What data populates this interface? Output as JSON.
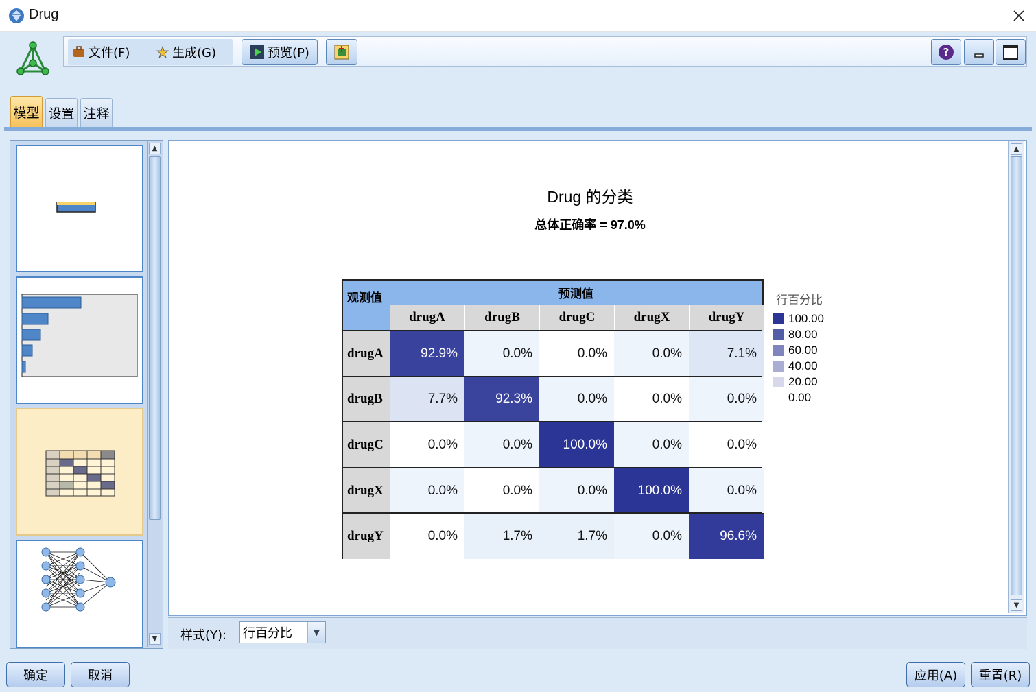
{
  "window": {
    "title": "Drug"
  },
  "toolbar": {
    "file_menu": "文件(F)",
    "generate_menu": "生成(G)",
    "preview_button": "预览(P)"
  },
  "tabs": [
    {
      "label": "模型",
      "active": true
    },
    {
      "label": "设置",
      "active": false
    },
    {
      "label": "注释",
      "active": false
    }
  ],
  "chart_data": {
    "type": "heatmap",
    "title": "Drug 的分类",
    "subtitle": "总体正确率 = 97.0%",
    "row_header": "观测值",
    "column_header": "预测值",
    "columns": [
      "drugA",
      "drugB",
      "drugC",
      "drugX",
      "drugY"
    ],
    "rows": [
      {
        "label": "drugA",
        "values": [
          92.9,
          0.0,
          0.0,
          0.0,
          7.1
        ],
        "display": [
          "92.9%",
          "0.0%",
          "0.0%",
          "0.0%",
          "7.1%"
        ]
      },
      {
        "label": "drugB",
        "values": [
          7.7,
          92.3,
          0.0,
          0.0,
          0.0
        ],
        "display": [
          "7.7%",
          "92.3%",
          "0.0%",
          "0.0%",
          "0.0%"
        ]
      },
      {
        "label": "drugC",
        "values": [
          0.0,
          0.0,
          100.0,
          0.0,
          0.0
        ],
        "display": [
          "0.0%",
          "0.0%",
          "100.0%",
          "0.0%",
          "0.0%"
        ]
      },
      {
        "label": "drugX",
        "values": [
          0.0,
          0.0,
          0.0,
          100.0,
          0.0
        ],
        "display": [
          "0.0%",
          "0.0%",
          "0.0%",
          "100.0%",
          "0.0%"
        ]
      },
      {
        "label": "drugY",
        "values": [
          0.0,
          1.7,
          1.7,
          0.0,
          96.6
        ],
        "display": [
          "0.0%",
          "1.7%",
          "1.7%",
          "0.0%",
          "96.6%"
        ]
      }
    ],
    "legend": {
      "title": "行百分比",
      "items": [
        {
          "label": "100.00",
          "color": "#2b3595"
        },
        {
          "label": "80.00",
          "color": "#545ea7"
        },
        {
          "label": "60.00",
          "color": "#8085bd"
        },
        {
          "label": "40.00",
          "color": "#aaaed4"
        },
        {
          "label": "20.00",
          "color": "#d7d9eb"
        },
        {
          "label": "0.00",
          "color": "#ffffff"
        }
      ]
    }
  },
  "style_bar": {
    "label": "样式(Y):",
    "selected": "行百分比"
  },
  "buttons": {
    "ok": "确定",
    "cancel": "取消",
    "apply": "应用(A)",
    "reset": "重置(R)"
  }
}
